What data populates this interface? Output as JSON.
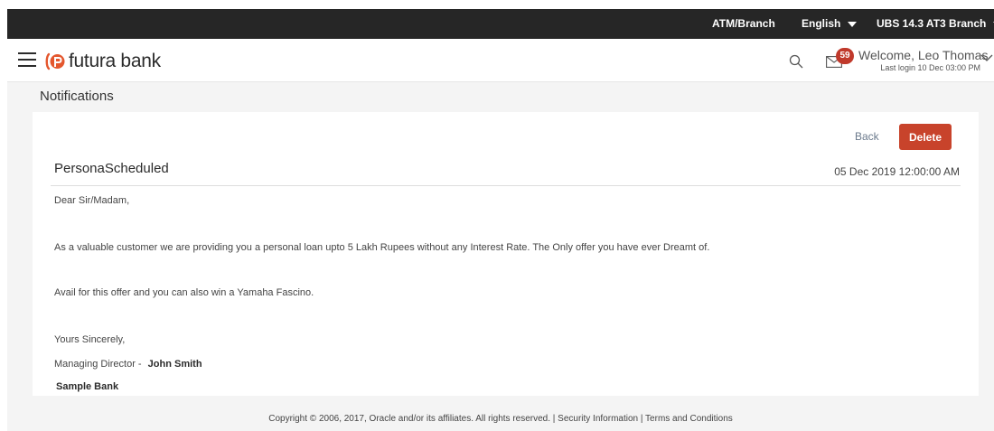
{
  "topbar": {
    "atm_branch": "ATM/Branch",
    "language": "English",
    "branch": "UBS 14.3 AT3 Branch"
  },
  "header": {
    "logo_text": "futura bank",
    "mail_badge_count": "59",
    "welcome_text": "Welcome, Leo Thomas",
    "last_login": "Last login 10 Dec 03:00 PM"
  },
  "page": {
    "title": "Notifications"
  },
  "actions": {
    "back_label": "Back",
    "delete_label": "Delete"
  },
  "message": {
    "subject": "PersonaScheduled",
    "date": "05 Dec 2019 12:00:00 AM",
    "greeting": "Dear Sir/Madam,",
    "paragraph1": "As a valuable customer we are providing you a personal loan upto 5 Lakh Rupees without any Interest Rate. The Only offer you have ever Dreamt of.",
    "paragraph2": "Avail for this offer and you can also win a Yamaha Fascino.",
    "closing": "Yours Sincerely,",
    "signature_role": "Managing Director -",
    "signature_name": "John Smith",
    "signature_org": "Sample Bank"
  },
  "footer": {
    "text": "Copyright © 2006, 2017, Oracle and/or its affiliates. All rights reserved. | Security Information | Terms and Conditions"
  },
  "colors": {
    "topbar_bg": "#262626",
    "accent_red": "#c8432b",
    "logo_orange": "#e4572e",
    "page_bg": "#f4f4f4"
  }
}
